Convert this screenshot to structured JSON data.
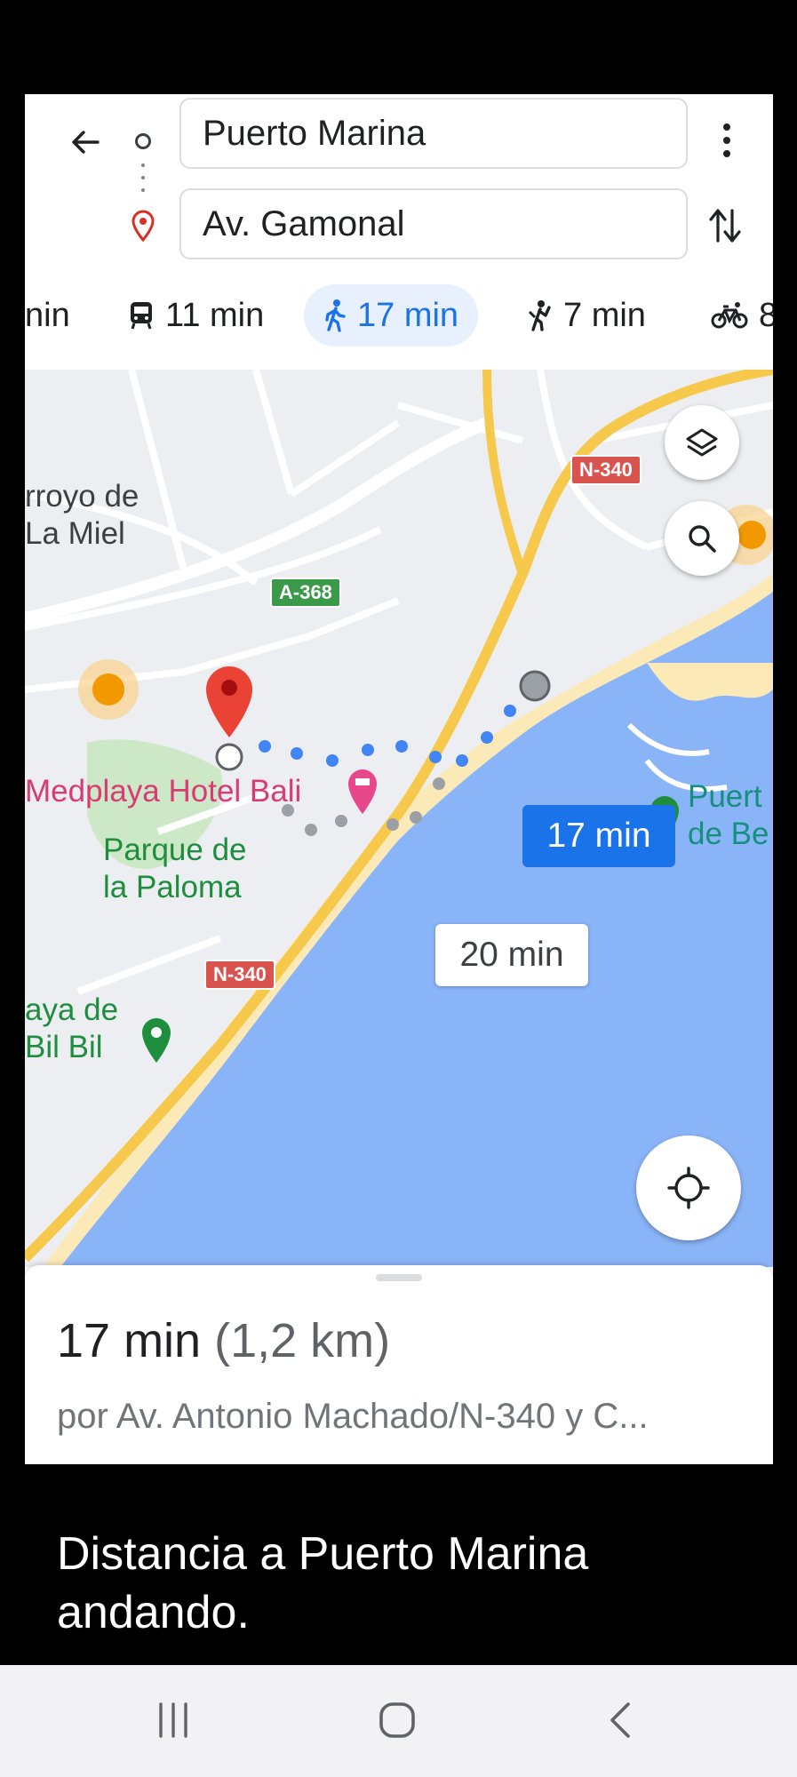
{
  "search": {
    "origin": "Puerto Marina",
    "destination": "Av. Gamonal"
  },
  "travel_modes": [
    {
      "icon": "car-icon",
      "label": "nin"
    },
    {
      "icon": "transit-icon",
      "label": "11 min"
    },
    {
      "icon": "walk-icon",
      "label": "17 min",
      "selected": true
    },
    {
      "icon": "rideshare-icon",
      "label": "7 min"
    },
    {
      "icon": "bike-icon",
      "label": "8"
    }
  ],
  "map": {
    "roads": [
      "N-340",
      "A-368",
      "N-340"
    ],
    "places": {
      "arroyo": "rroyo de\nLa Miel",
      "hotel": "Medplaya Hotel Bali",
      "park": "Parque de\nla Paloma",
      "beach": "aya de\nBil Bil",
      "port": "Puert\nde Be"
    },
    "route_primary_label": "17 min",
    "route_alt_label": "20 min"
  },
  "summary": {
    "duration": "17 min",
    "distance": "(1,2 km)",
    "via": "por Av. Antonio Machado/N-340 y C..."
  },
  "caption": "Distancia a Puerto Marina andando.",
  "colors": {
    "primary": "#1a73e8",
    "pin": "#ea4335",
    "water": "#8ab4f8",
    "road": "#f6c94c"
  }
}
